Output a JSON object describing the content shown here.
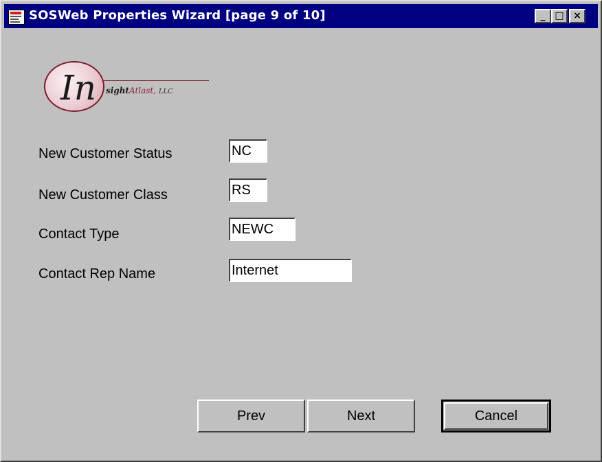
{
  "window": {
    "title": "SOSWeb Properties Wizard  [page 9 of 10]",
    "icon": "app-icon",
    "controls": {
      "minimize": "_",
      "maximize": "□",
      "close": "×"
    }
  },
  "logo": {
    "initials": "In",
    "text_main": "sight",
    "text_brand": "Atlast,",
    "text_suffix": "LLC",
    "colors": {
      "accent": "#7a1c2e",
      "brand": "#8b1f36"
    }
  },
  "form": {
    "fields": [
      {
        "label": "New Customer Status",
        "value": "NC"
      },
      {
        "label": "New Customer Class",
        "value": "RS"
      },
      {
        "label": "Contact Type",
        "value": "NEWC"
      },
      {
        "label": "Contact Rep Name",
        "value": "Internet"
      }
    ]
  },
  "buttons": {
    "prev": "Prev",
    "next": "Next",
    "cancel": "Cancel"
  },
  "colors": {
    "titlebar": "#000080",
    "background": "#c0c0c0"
  }
}
